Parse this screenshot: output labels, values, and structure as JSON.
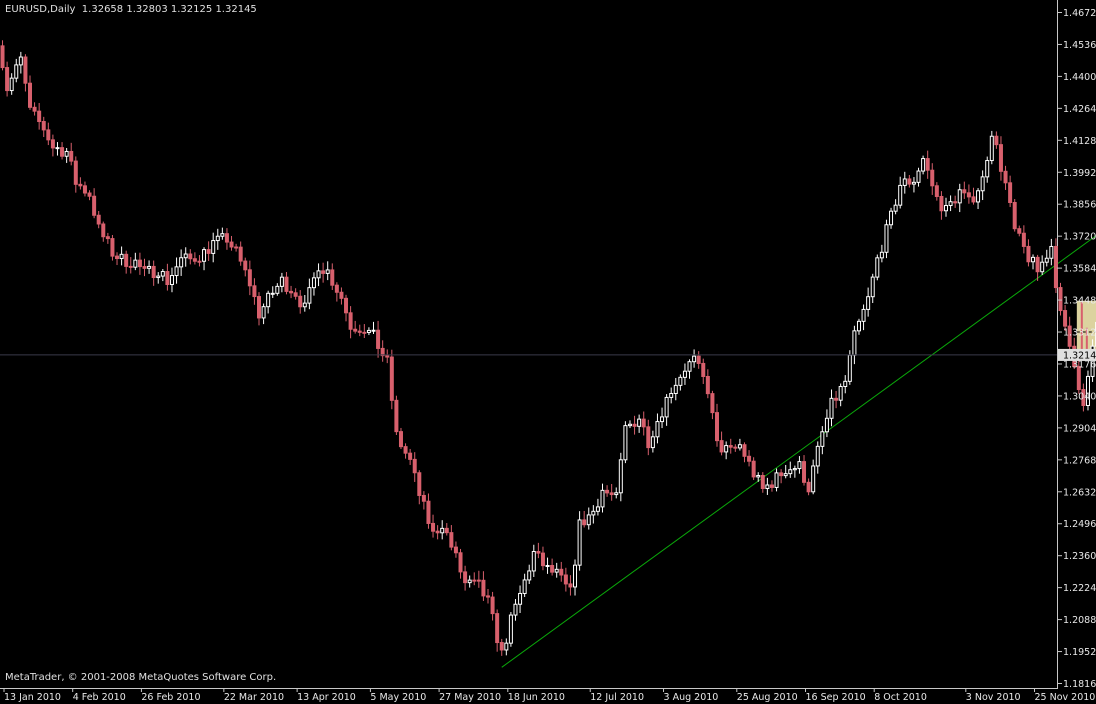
{
  "header": {
    "symbol": "EURUSD,Daily",
    "open": "1.32658",
    "high": "1.32803",
    "low": "1.32125",
    "close": "1.32145"
  },
  "footer": {
    "copyright": "MetaTrader, © 2001-2008 MetaQuotes Software Corp."
  },
  "current_price_label": "1.32145",
  "colors": {
    "background": "#000000",
    "bull": "#ffffff",
    "bear": "#d8606d",
    "trendline": "#0aa80a",
    "highlight": "#f4eab0",
    "axis": "#c8c8c8"
  },
  "chart_data": {
    "type": "candlestick",
    "symbol": "EURUSD",
    "timeframe": "Daily",
    "y_ticks": [
      "1.46720",
      "1.45360",
      "1.44000",
      "1.42640",
      "1.41280",
      "1.39920",
      "1.38560",
      "1.37200",
      "1.35840",
      "1.34480",
      "1.33120",
      "1.31760",
      "1.30400",
      "1.29040",
      "1.27680",
      "1.26320",
      "1.24960",
      "1.23600",
      "1.22240",
      "1.20880",
      "1.19520",
      "1.18160"
    ],
    "ylim": [
      1.1816,
      1.4672
    ],
    "x_ticks": [
      "13 Jan 2010",
      "4 Feb 2010",
      "26 Feb 2010",
      "22 Mar 2010",
      "13 Apr 2010",
      "5 May 2010",
      "27 May 2010",
      "18 Jun 2010",
      "12 Jul 2010",
      "3 Aug 2010",
      "25 Aug 2010",
      "16 Sep 2010",
      "8 Oct 2010",
      "3 Nov 2010",
      "25 Nov 2010"
    ],
    "current_price": 1.32145,
    "trendline": {
      "from": {
        "date": "2010-06-07",
        "price": 1.1885
      },
      "to": {
        "date": "2010-12-22",
        "price": 1.3895
      }
    },
    "highlight_box": {
      "from_date": "2010-11-30",
      "to_date": "2010-12-06",
      "high": 1.3445,
      "low": 1.319
    },
    "path": [
      [
        "2010-01-04",
        1.456
      ],
      [
        "2010-01-07",
        1.435
      ],
      [
        "2010-01-11",
        1.447
      ],
      [
        "2010-01-14",
        1.425
      ],
      [
        "2010-01-18",
        1.418
      ],
      [
        "2010-01-21",
        1.41
      ],
      [
        "2010-01-25",
        1.408
      ],
      [
        "2010-01-28",
        1.395
      ],
      [
        "2010-02-01",
        1.39
      ],
      [
        "2010-02-04",
        1.375
      ],
      [
        "2010-02-08",
        1.365
      ],
      [
        "2010-02-11",
        1.362
      ],
      [
        "2010-02-15",
        1.361
      ],
      [
        "2010-02-18",
        1.356
      ],
      [
        "2010-02-22",
        1.358
      ],
      [
        "2010-02-25",
        1.353
      ],
      [
        "2010-03-01",
        1.362
      ],
      [
        "2010-03-04",
        1.362
      ],
      [
        "2010-03-08",
        1.365
      ],
      [
        "2010-03-11",
        1.369
      ],
      [
        "2010-03-15",
        1.371
      ],
      [
        "2010-03-18",
        1.365
      ],
      [
        "2010-03-22",
        1.352
      ],
      [
        "2010-03-25",
        1.339
      ],
      [
        "2010-03-29",
        1.348
      ],
      [
        "2010-04-01",
        1.353
      ],
      [
        "2010-04-05",
        1.348
      ],
      [
        "2010-04-08",
        1.341
      ],
      [
        "2010-04-12",
        1.36
      ],
      [
        "2010-04-15",
        1.357
      ],
      [
        "2010-04-19",
        1.346
      ],
      [
        "2010-04-22",
        1.334
      ],
      [
        "2010-04-26",
        1.333
      ],
      [
        "2010-04-29",
        1.329
      ],
      [
        "2010-05-03",
        1.318
      ],
      [
        "2010-05-06",
        1.287
      ],
      [
        "2010-05-10",
        1.276
      ],
      [
        "2010-05-13",
        1.262
      ],
      [
        "2010-05-17",
        1.245
      ],
      [
        "2010-05-20",
        1.25
      ],
      [
        "2010-05-24",
        1.235
      ],
      [
        "2010-05-27",
        1.224
      ],
      [
        "2010-05-31",
        1.223
      ],
      [
        "2010-06-03",
        1.216
      ],
      [
        "2010-06-07",
        1.194
      ],
      [
        "2010-06-10",
        1.208
      ],
      [
        "2010-06-14",
        1.225
      ],
      [
        "2010-06-17",
        1.237
      ],
      [
        "2010-06-21",
        1.23
      ],
      [
        "2010-06-24",
        1.228
      ],
      [
        "2010-06-28",
        1.22
      ],
      [
        "2010-07-01",
        1.249
      ],
      [
        "2010-07-05",
        1.255
      ],
      [
        "2010-07-08",
        1.264
      ],
      [
        "2010-07-12",
        1.26
      ],
      [
        "2010-07-15",
        1.29
      ],
      [
        "2010-07-19",
        1.295
      ],
      [
        "2010-07-22",
        1.285
      ],
      [
        "2010-07-26",
        1.298
      ],
      [
        "2010-07-29",
        1.307
      ],
      [
        "2010-08-02",
        1.316
      ],
      [
        "2010-08-05",
        1.319
      ],
      [
        "2010-08-09",
        1.307
      ],
      [
        "2010-08-12",
        1.283
      ],
      [
        "2010-08-16",
        1.28
      ],
      [
        "2010-08-19",
        1.283
      ],
      [
        "2010-08-23",
        1.271
      ],
      [
        "2010-08-26",
        1.264
      ],
      [
        "2010-08-30",
        1.269
      ],
      [
        "2010-09-02",
        1.273
      ],
      [
        "2010-09-06",
        1.274
      ],
      [
        "2010-09-09",
        1.265
      ],
      [
        "2010-09-13",
        1.288
      ],
      [
        "2010-09-16",
        1.3
      ],
      [
        "2010-09-20",
        1.31
      ],
      [
        "2010-09-23",
        1.329
      ],
      [
        "2010-09-27",
        1.345
      ],
      [
        "2010-09-30",
        1.362
      ],
      [
        "2010-10-04",
        1.38
      ],
      [
        "2010-10-07",
        1.394
      ],
      [
        "2010-10-11",
        1.396
      ],
      [
        "2010-10-14",
        1.405
      ],
      [
        "2010-10-18",
        1.388
      ],
      [
        "2010-10-21",
        1.383
      ],
      [
        "2010-10-25",
        1.391
      ],
      [
        "2010-10-28",
        1.386
      ],
      [
        "2010-11-01",
        1.396
      ],
      [
        "2010-11-04",
        1.417
      ],
      [
        "2010-11-08",
        1.394
      ],
      [
        "2010-11-11",
        1.374
      ],
      [
        "2010-11-15",
        1.363
      ],
      [
        "2010-11-18",
        1.357
      ],
      [
        "2010-11-22",
        1.368
      ],
      [
        "2010-11-25",
        1.338
      ],
      [
        "2010-11-29",
        1.319
      ],
      [
        "2010-12-02",
        1.299
      ],
      [
        "2010-12-06",
        1.335
      ],
      [
        "2010-12-09",
        1.33
      ],
      [
        "2010-12-13",
        1.3215
      ]
    ]
  }
}
